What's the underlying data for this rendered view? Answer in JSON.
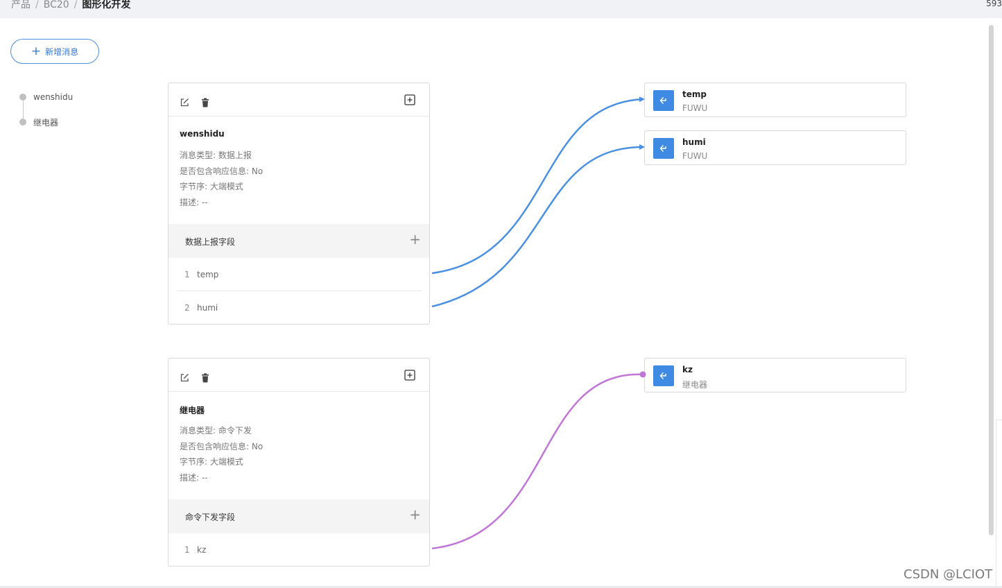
{
  "breadcrumb": {
    "item1": "产品",
    "item2": "BC20",
    "current": "图形化开发",
    "separator": "/"
  },
  "corner_number": "593",
  "toolbar": {
    "add_message_label": "新增消息"
  },
  "sidebar": {
    "items": [
      {
        "label": "wenshidu"
      },
      {
        "label": "继电器"
      }
    ]
  },
  "messages": [
    {
      "title": "wenshidu",
      "info": {
        "type": "消息类型: 数据上报",
        "response": "是否包含响应信息: No",
        "byte_order": "字节序: 大端模式",
        "desc": "描述: --"
      },
      "section_label": "数据上报字段",
      "fields": [
        {
          "index": "1",
          "name": "temp"
        },
        {
          "index": "2",
          "name": "humi"
        }
      ]
    },
    {
      "title": "继电器",
      "info": {
        "type": "消息类型: 命令下发",
        "response": "是否包含响应信息: No",
        "byte_order": "字节序: 大端模式",
        "desc": "描述: --"
      },
      "section_label": "命令下发字段",
      "fields": [
        {
          "index": "1",
          "name": "kz"
        }
      ]
    }
  ],
  "targets": [
    {
      "name": "temp",
      "sub": "FUWU"
    },
    {
      "name": "humi",
      "sub": "FUWU"
    },
    {
      "name": "kz",
      "sub": "继电器"
    }
  ],
  "colors": {
    "accent": "#3f8be3",
    "report_link": "#4a90e2",
    "command_link": "#c175d6"
  },
  "icons": {
    "edit": "edit-icon",
    "delete": "trash-icon",
    "add": "add-square-icon",
    "target": "service-arrow-icon"
  },
  "watermark": "CSDN @LCIOT"
}
